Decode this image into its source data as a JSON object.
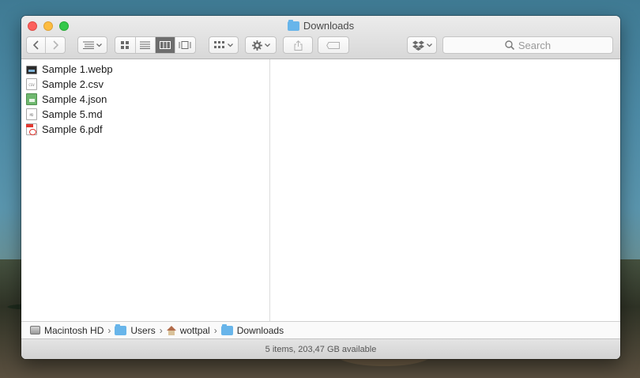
{
  "window": {
    "title": "Downloads"
  },
  "toolbar": {
    "back_icon": "chevron-left",
    "forward_icon": "chevron-right",
    "search_placeholder": "Search"
  },
  "files": [
    {
      "name": "Sample 1.webp",
      "icon": "image-file-icon"
    },
    {
      "name": "Sample 2.csv",
      "icon": "csv-file-icon"
    },
    {
      "name": "Sample 4.json",
      "icon": "json-file-icon"
    },
    {
      "name": "Sample 5.md",
      "icon": "md-file-icon"
    },
    {
      "name": "Sample 6.pdf",
      "icon": "pdf-file-icon"
    }
  ],
  "path": {
    "items": [
      "Macintosh HD",
      "Users",
      "wottpal",
      "Downloads"
    ],
    "separator": "›"
  },
  "status": {
    "text": "5 items, 203,47 GB available"
  },
  "colors": {
    "accent": "#68b5ea",
    "close": "#fc605c",
    "minimize": "#fdbc40",
    "maximize": "#34c84a"
  }
}
